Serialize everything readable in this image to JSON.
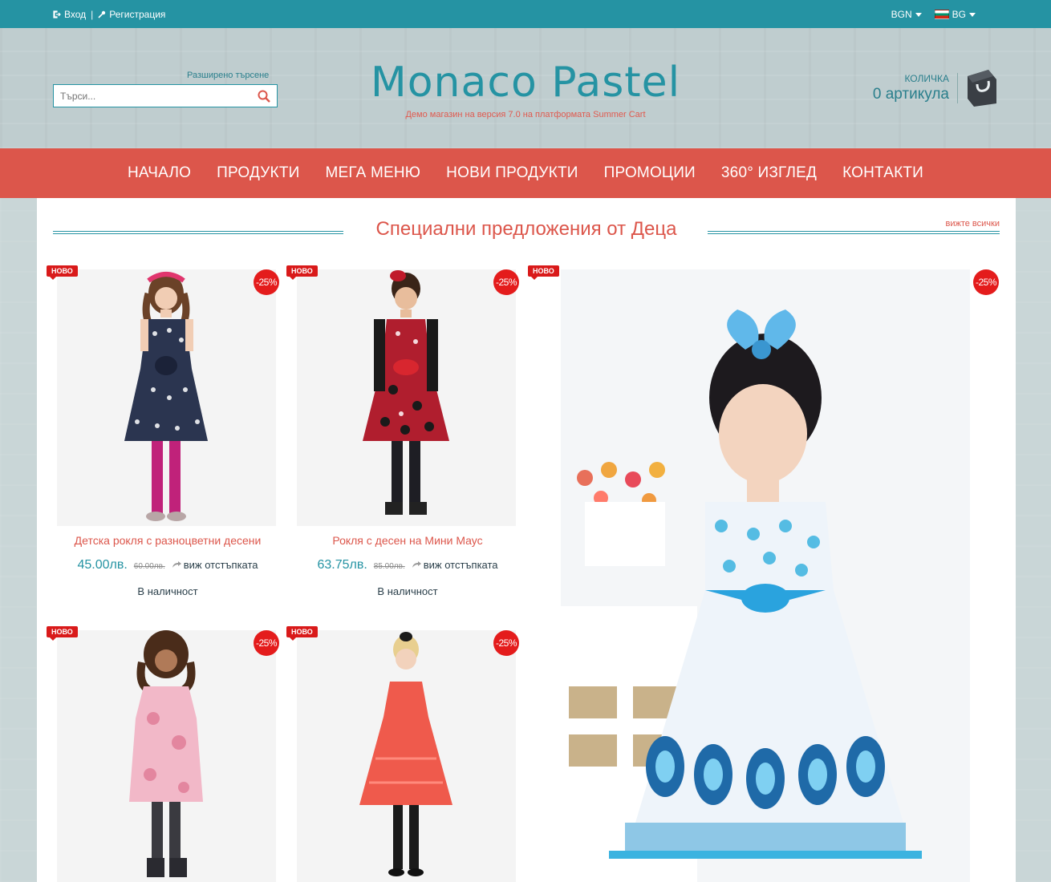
{
  "topbar": {
    "login": "Вход",
    "register": "Регистрация",
    "currency": "BGN",
    "language": "BG"
  },
  "header": {
    "advanced_search": "Разширено търсене",
    "search_placeholder": "Търси...",
    "logo": "Monaco Pastel",
    "tagline": "Демо магазин на версия 7.0 на платформата Summer Cart",
    "cart_label": "КОЛИЧКА",
    "cart_count": "0 артикула"
  },
  "nav": [
    "НАЧАЛО",
    "ПРОДУКТИ",
    "МЕГА МЕНЮ",
    "НОВИ ПРОДУКТИ",
    "ПРОМОЦИИ",
    "360° ИЗГЛЕД",
    "КОНТАКТИ"
  ],
  "section": {
    "title": "Специални предложения от Деца",
    "see_all": "вижте всички"
  },
  "products": [
    {
      "badge": "НОВО",
      "discount": "-25%",
      "name": "Детска рокля с разноцветни десени",
      "price": "45.00лв.",
      "old_price": "60.00лв.",
      "see_discount": "виж отстъпката",
      "stock": "В наличност",
      "dress_color": "#2b3550",
      "dots": "#ffffff",
      "legs": "#c0227a"
    },
    {
      "badge": "НОВО",
      "discount": "-25%",
      "name": "Рокля с десен на Мини Маус",
      "price": "63.75лв.",
      "old_price": "85.00лв.",
      "see_discount": "виж отстъпката",
      "stock": "В наличност",
      "dress_color": "#b01e2e",
      "dots": "#f4d9dd",
      "legs": "#1e1e24"
    },
    {
      "badge": "НОВО",
      "discount": "-25%",
      "dress_color": "#f2b8c8",
      "dots": "#e07a95",
      "legs": "#3a3a40"
    },
    {
      "badge": "НОВО",
      "discount": "-25%",
      "dress_color": "#ef5a4c",
      "dots": "#ff8a7c",
      "legs": "#1a1a1a"
    }
  ],
  "featured": {
    "badge": "НОВО",
    "discount": "-25%",
    "dress_color": "#3bb3e0"
  }
}
